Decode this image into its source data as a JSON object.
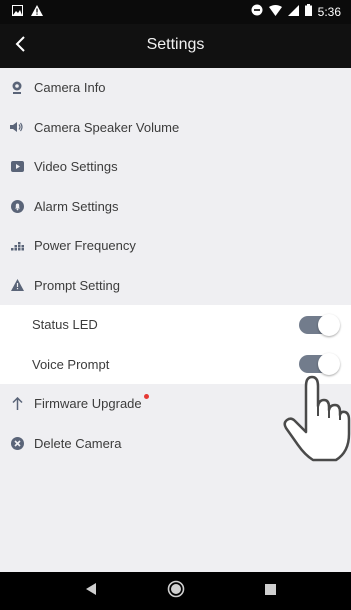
{
  "status_bar": {
    "time": "5:36"
  },
  "app_bar": {
    "title": "Settings"
  },
  "menu": [
    {
      "label": "Camera Info",
      "icon": "camera-icon"
    },
    {
      "label": "Camera Speaker Volume",
      "icon": "speaker-icon"
    },
    {
      "label": "Video Settings",
      "icon": "video-icon"
    },
    {
      "label": "Alarm Settings",
      "icon": "alarm-icon"
    },
    {
      "label": "Power Frequency",
      "icon": "power-frequency-icon"
    },
    {
      "label": "Prompt Setting",
      "icon": "warning-icon"
    },
    {
      "label": "Status LED",
      "toggle": true,
      "on": true
    },
    {
      "label": "Voice Prompt",
      "toggle": true,
      "on": true
    },
    {
      "label": "Firmware Upgrade",
      "icon": "arrow-up-icon",
      "badge": "red-dot"
    },
    {
      "label": "Delete Camera",
      "icon": "delete-icon"
    }
  ],
  "colors": {
    "toggle_track": "#727c8c",
    "badge": "#e53935",
    "icon": "#5a6478"
  }
}
